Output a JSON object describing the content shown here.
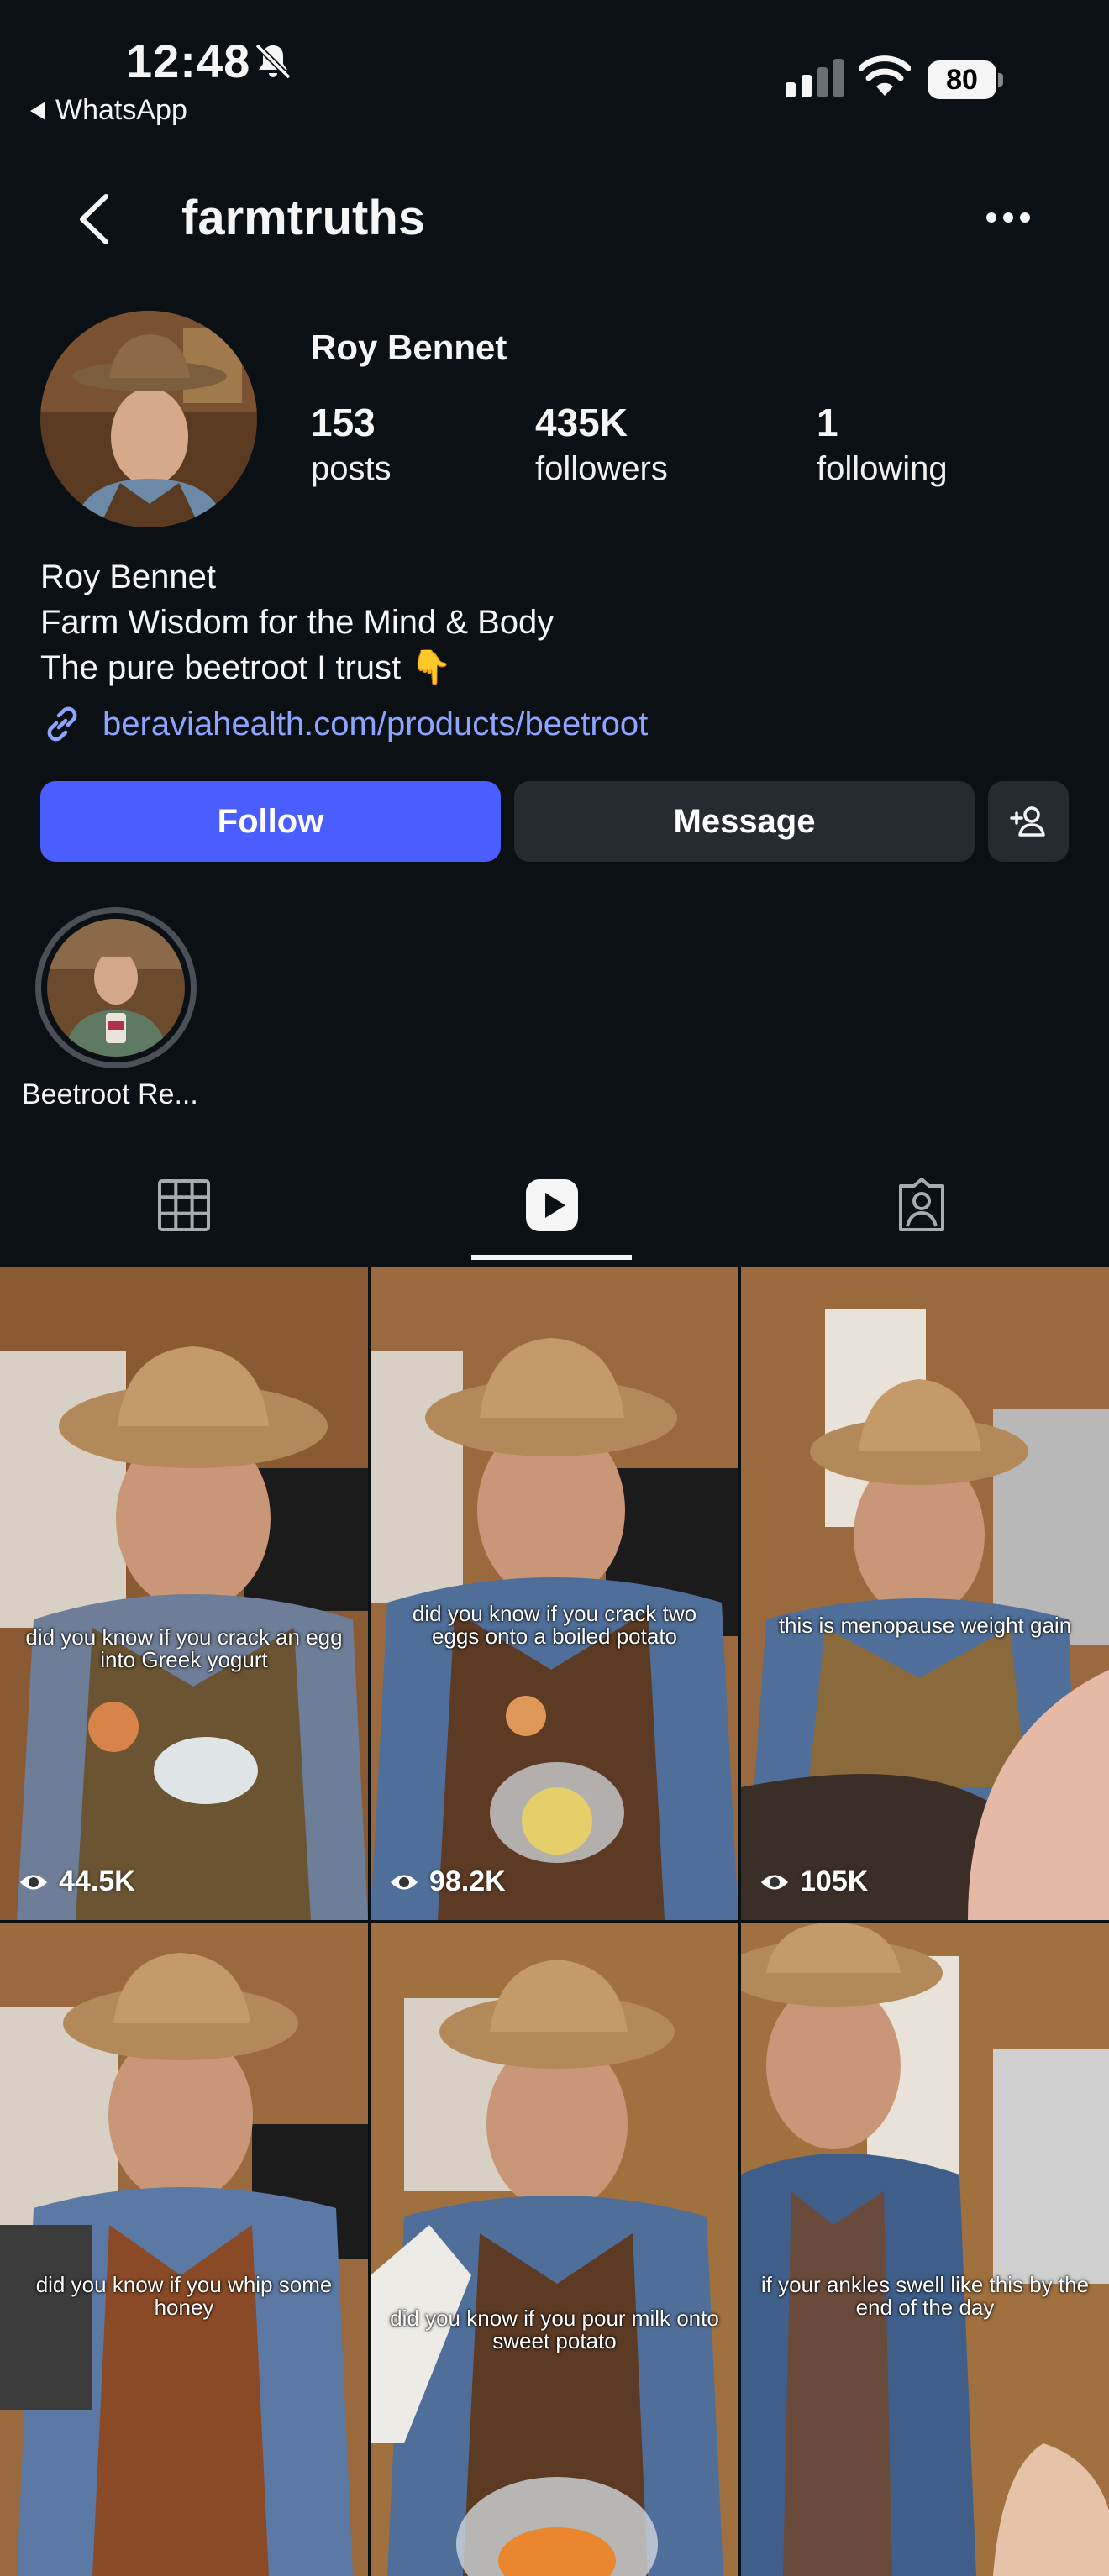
{
  "status_bar": {
    "time": "12:48",
    "back_app": "WhatsApp",
    "battery": "80"
  },
  "header": {
    "username": "farmtruths"
  },
  "profile": {
    "display_name": "Roy Bennet",
    "stats": [
      {
        "value": "153",
        "label": "posts"
      },
      {
        "value": "435K",
        "label": "followers"
      },
      {
        "value": "1",
        "label": "following"
      }
    ],
    "bio": [
      "Roy Bennet",
      "Farm Wisdom for the Mind & Body",
      "The pure beetroot I trust 👇"
    ],
    "link": "beraviahealth.com/products/beetroot"
  },
  "actions": {
    "follow": "Follow",
    "message": "Message"
  },
  "highlight": {
    "label": "Beetroot Re..."
  },
  "tabs": [
    "grid-icon",
    "reels-icon",
    "tagged-icon"
  ],
  "reels": [
    {
      "caption": "did you know if you crack an egg into Greek yogurt",
      "views": "44.5K"
    },
    {
      "caption": "did you know if you crack two eggs onto a boiled potato",
      "views": "98.2K"
    },
    {
      "caption": "this is menopause weight gain",
      "views": "105K"
    },
    {
      "caption": "did you know if you whip some honey",
      "views": ""
    },
    {
      "caption": "did you know if you pour milk onto sweet potato",
      "views": ""
    },
    {
      "caption": "if your ankles swell like this by the end of the day",
      "views": ""
    }
  ],
  "colors": {
    "background": "#0b1014",
    "follow_button": "#4a5dff",
    "secondary_button": "#262a31",
    "link": "#8ea5ff"
  }
}
